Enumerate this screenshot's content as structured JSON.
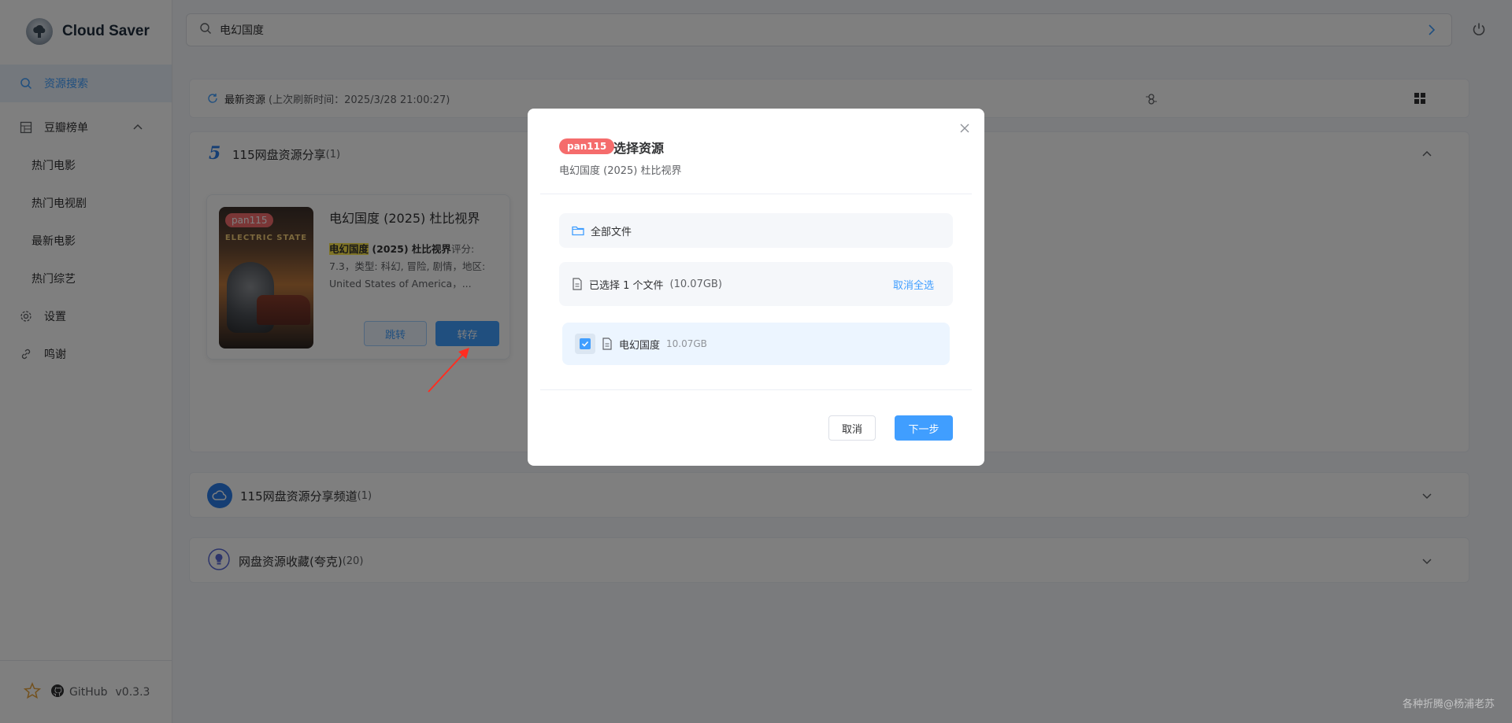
{
  "app": {
    "title": "Cloud Saver",
    "github_label": "GitHub",
    "version": "v0.3.3"
  },
  "sidebar": {
    "items": [
      {
        "label": "资源搜索",
        "icon": "search-icon"
      },
      {
        "label": "豆瓣榜单",
        "icon": "grid-icon"
      },
      {
        "label": "热门电影"
      },
      {
        "label": "热门电视剧"
      },
      {
        "label": "最新电影"
      },
      {
        "label": "热门综艺"
      },
      {
        "label": "设置",
        "icon": "gear-icon"
      },
      {
        "label": "鸣谢",
        "icon": "link-icon"
      }
    ]
  },
  "search": {
    "value": "电幻国度"
  },
  "refresh": {
    "label": "最新资源",
    "sub": "(上次刷新时间：2025/3/28 21:00:27)"
  },
  "panels": [
    {
      "title": "115网盘资源分享",
      "count": "(1)"
    },
    {
      "title": "115网盘资源分享频道",
      "count": "(1)"
    },
    {
      "title": "网盘资源收藏(夸克)",
      "count": "(20)"
    }
  ],
  "card": {
    "tag": "pan115",
    "poster_text": "ELECTRIC STATE",
    "title": "电幻国度 (2025) 杜比视界",
    "desc_highlight": "电幻国度",
    "desc_bold": " (2025) 杜比视界",
    "desc_rest": "评分: 7.3，类型: 科幻, 冒险, 剧情，地区: United States of America，...",
    "jump_label": "跳转",
    "save_label": "转存"
  },
  "dialog": {
    "tag": "pan115",
    "title": "选择资源",
    "subtitle": "电幻国度 (2025) 杜比视界",
    "all_files": "全部文件",
    "selected_text": "已选择 1 个文件",
    "selected_size": "(10.07GB)",
    "deselect_all": "取消全选",
    "file_name": "电幻国度",
    "file_size": "10.07GB",
    "cancel_label": "取消",
    "next_label": "下一步"
  },
  "watermark": "各种折腾@杨浦老苏",
  "colors": {
    "accent": "#409eff",
    "tag": "#f56c6c",
    "highlight": "#ffe94d"
  }
}
